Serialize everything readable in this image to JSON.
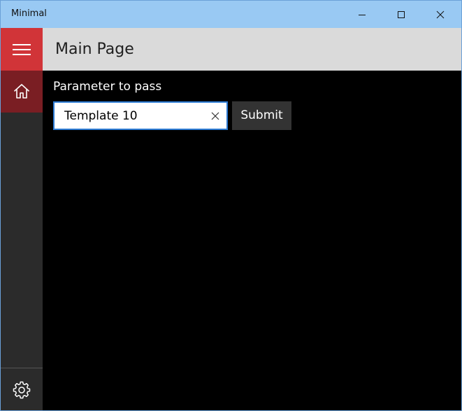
{
  "window": {
    "title": "Minimal"
  },
  "header": {
    "title": "Main Page"
  },
  "sidebar": {
    "menu_icon": "hamburger-icon",
    "items": [
      {
        "id": "home",
        "icon": "home-icon",
        "selected": true
      },
      {
        "id": "settings",
        "icon": "gear-icon",
        "selected": false
      }
    ]
  },
  "form": {
    "label": "Parameter to pass",
    "value": "Template 10",
    "submit_label": "Submit"
  },
  "colors": {
    "accent": "#d13438",
    "selected_nav": "#7a1e23",
    "titlebar": "#99c9f3",
    "focus_border": "#2d7bd4"
  }
}
